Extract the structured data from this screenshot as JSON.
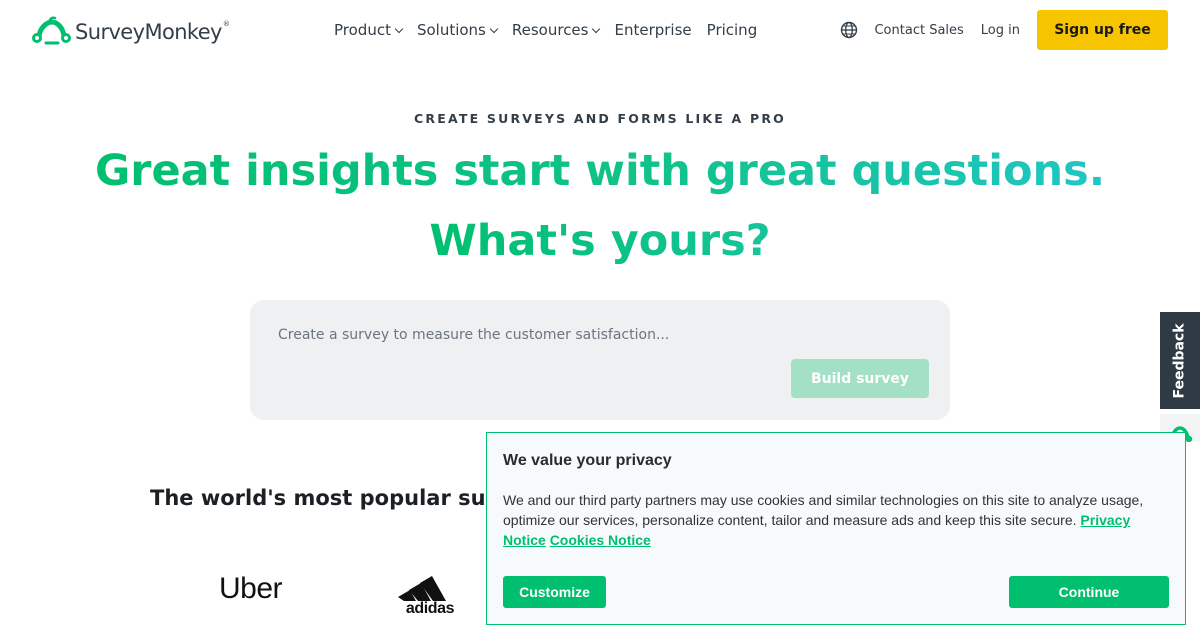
{
  "brand": {
    "name": "SurveyMonkey",
    "mark": "®",
    "color": "#00bf6f"
  },
  "nav": {
    "items": [
      {
        "label": "Product",
        "dropdown": true
      },
      {
        "label": "Solutions",
        "dropdown": true
      },
      {
        "label": "Resources",
        "dropdown": true
      },
      {
        "label": "Enterprise",
        "dropdown": false
      },
      {
        "label": "Pricing",
        "dropdown": false
      }
    ]
  },
  "header": {
    "language_icon": "globe-icon",
    "contact_sales": "Contact Sales",
    "login": "Log in",
    "signup": "Sign up free",
    "signup_color": "#f7c500"
  },
  "hero": {
    "eyebrow": "CREATE SURVEYS AND FORMS LIKE A PRO",
    "headline_line1": "Great insights start with great questions.",
    "headline_line2": "What's yours?",
    "accent_start": "#00bf6f",
    "accent_end": "#21c6c3"
  },
  "prompt": {
    "placeholder": "Create a survey to measure the customer satisfaction...",
    "value": "",
    "button": "Build survey",
    "button_state": "disabled"
  },
  "popular": {
    "heading": "The world's most popular surve"
  },
  "logos": {
    "uber": "Uber",
    "adidas": "adidas"
  },
  "feedback": {
    "label": "Feedback"
  },
  "cookie": {
    "title": "We value your privacy",
    "body": "We and our third party partners may use cookies and similar technologies on this site to analyze usage, optimize our services, personalize content, tailor and measure ads and keep this site secure.",
    "privacy_link": "Privacy Notice",
    "cookies_link": "Cookies Notice",
    "customize": "Customize",
    "continue": "Continue"
  }
}
